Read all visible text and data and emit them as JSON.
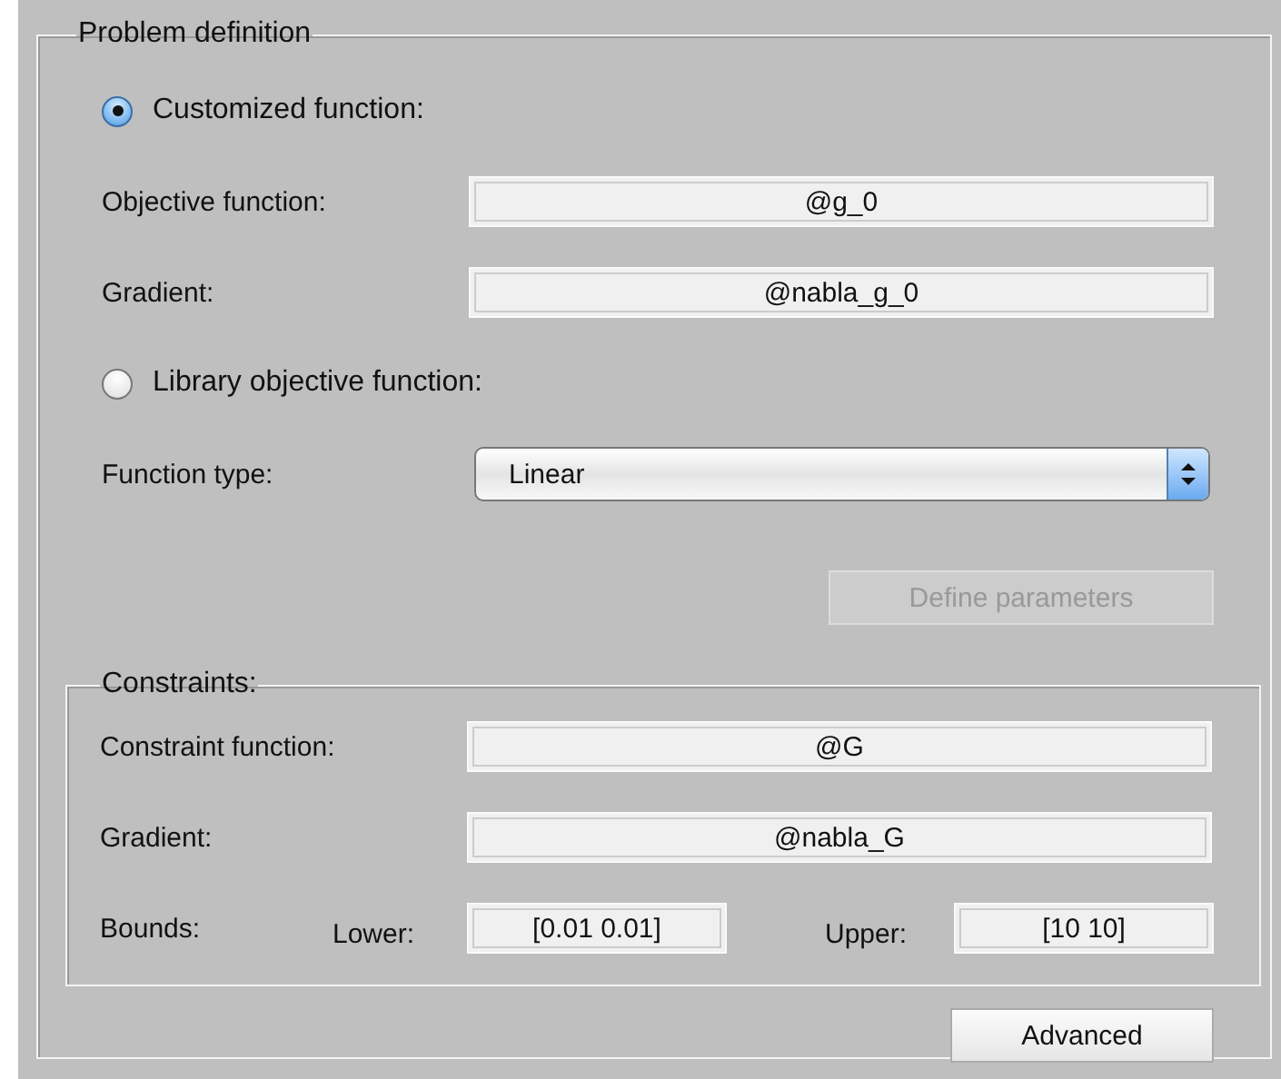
{
  "panel": {
    "title": "Problem definition",
    "rows": [
      {
        "kind": "radio",
        "label": "Customized function:",
        "selected": true
      },
      {
        "kind": "field",
        "label": "Objective function:",
        "value": "@g_0"
      },
      {
        "kind": "field",
        "label": "Gradient:",
        "value": "@nabla_g_0"
      },
      {
        "kind": "radio",
        "label": "Library objective function:",
        "selected": false
      },
      {
        "kind": "select",
        "label": "Function type:",
        "value": "Linear"
      },
      {
        "kind": "button",
        "label": "Define parameters",
        "disabled": true
      }
    ],
    "constraints": {
      "title": "Constraints:",
      "rows": [
        {
          "kind": "field",
          "label": "Constraint function:",
          "value": "@G"
        },
        {
          "kind": "field",
          "label": "Gradient:",
          "value": "@nabla_G"
        },
        {
          "kind": "bounds",
          "label": "Bounds:",
          "lower_label": "Lower:",
          "lower": "[0.01 0.01]",
          "upper_label": "Upper:",
          "upper": "[10 10]"
        }
      ]
    },
    "advanced": {
      "label": "Advanced",
      "disabled": false
    }
  }
}
